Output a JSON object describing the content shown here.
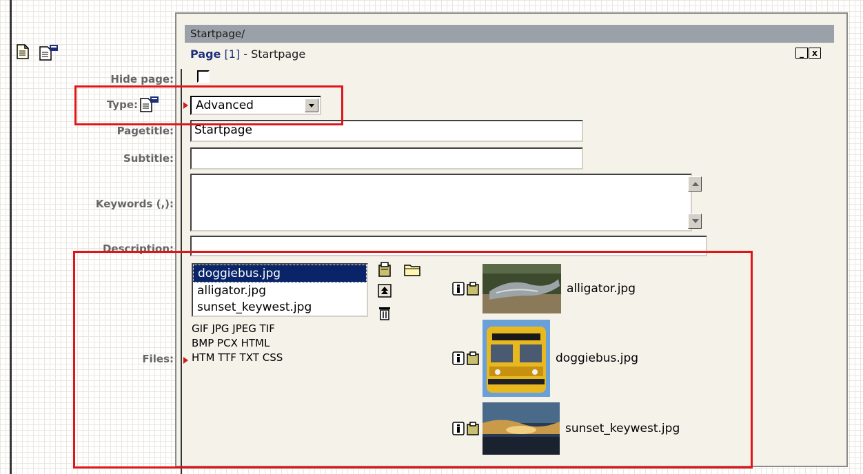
{
  "path": "Startpage/",
  "page_header": {
    "label": "Page",
    "number": "[1]",
    "separator": " - ",
    "name": "Startpage"
  },
  "window_controls": {
    "minimize": "_",
    "close": "x"
  },
  "labels": {
    "hide_page": "Hide page:",
    "type": "Type:",
    "pagetitle": "Pagetitle:",
    "subtitle": "Subtitle:",
    "keywords": "Keywords (,):",
    "description": "Description:",
    "files": "Files:"
  },
  "fields": {
    "type_value": "Advanced",
    "pagetitle_value": "Startpage",
    "subtitle_value": "",
    "description_value": ""
  },
  "files_list": [
    "doggiebus.jpg",
    "alligator.jpg",
    "sunset_keywest.jpg"
  ],
  "file_types": [
    "GIF JPG JPEG TIF",
    "BMP PCX HTML",
    "HTM TTF TXT CSS"
  ],
  "thumbnails": [
    "alligator.jpg",
    "doggiebus.jpg",
    "sunset_keywest.jpg"
  ],
  "colors": {
    "highlight": "#e0151a",
    "selection": "#0a246a",
    "path_bar": "#9aa1a8"
  }
}
